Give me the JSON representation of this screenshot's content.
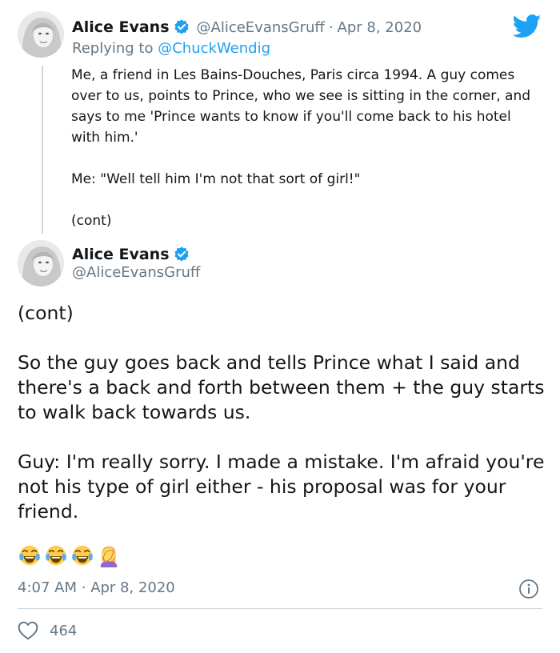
{
  "reply_tweet": {
    "author_name": "Alice Evans",
    "author_handle": "@AliceEvansGruff",
    "date": "Apr 8, 2020",
    "replying_prefix": "Replying to",
    "replying_to": "@ChuckWendig",
    "paragraphs": [
      "Me, a friend in Les Bains-Douches, Paris circa 1994. A guy comes over to us, points to Prince, who we see is sitting in the corner, and says to me 'Prince wants to know if you'll come back to his hotel with him.'",
      "Me: \"Well tell him I'm not that sort of girl!\"",
      "(cont)"
    ]
  },
  "main_tweet": {
    "author_name": "Alice Evans",
    "author_handle": "@AliceEvansGruff",
    "paragraphs": [
      "(cont)",
      "So the guy goes back and tells Prince what I said and there's a back and forth between them + the guy starts to walk back towards us.",
      "Guy: I'm really sorry. I made a mistake. I'm afraid you're not his type of girl either - his proposal was for your friend."
    ],
    "emojis": [
      "tears-of-joy-emoji",
      "tears-of-joy-emoji",
      "tears-of-joy-emoji",
      "facepalm-emoji"
    ],
    "time": "4:07 AM",
    "date": "Apr 8, 2020",
    "likes": "464"
  },
  "colors": {
    "text": "#14171a",
    "secondary": "#657786",
    "accent": "#1da1f2",
    "divider": "#ccd6dd"
  }
}
